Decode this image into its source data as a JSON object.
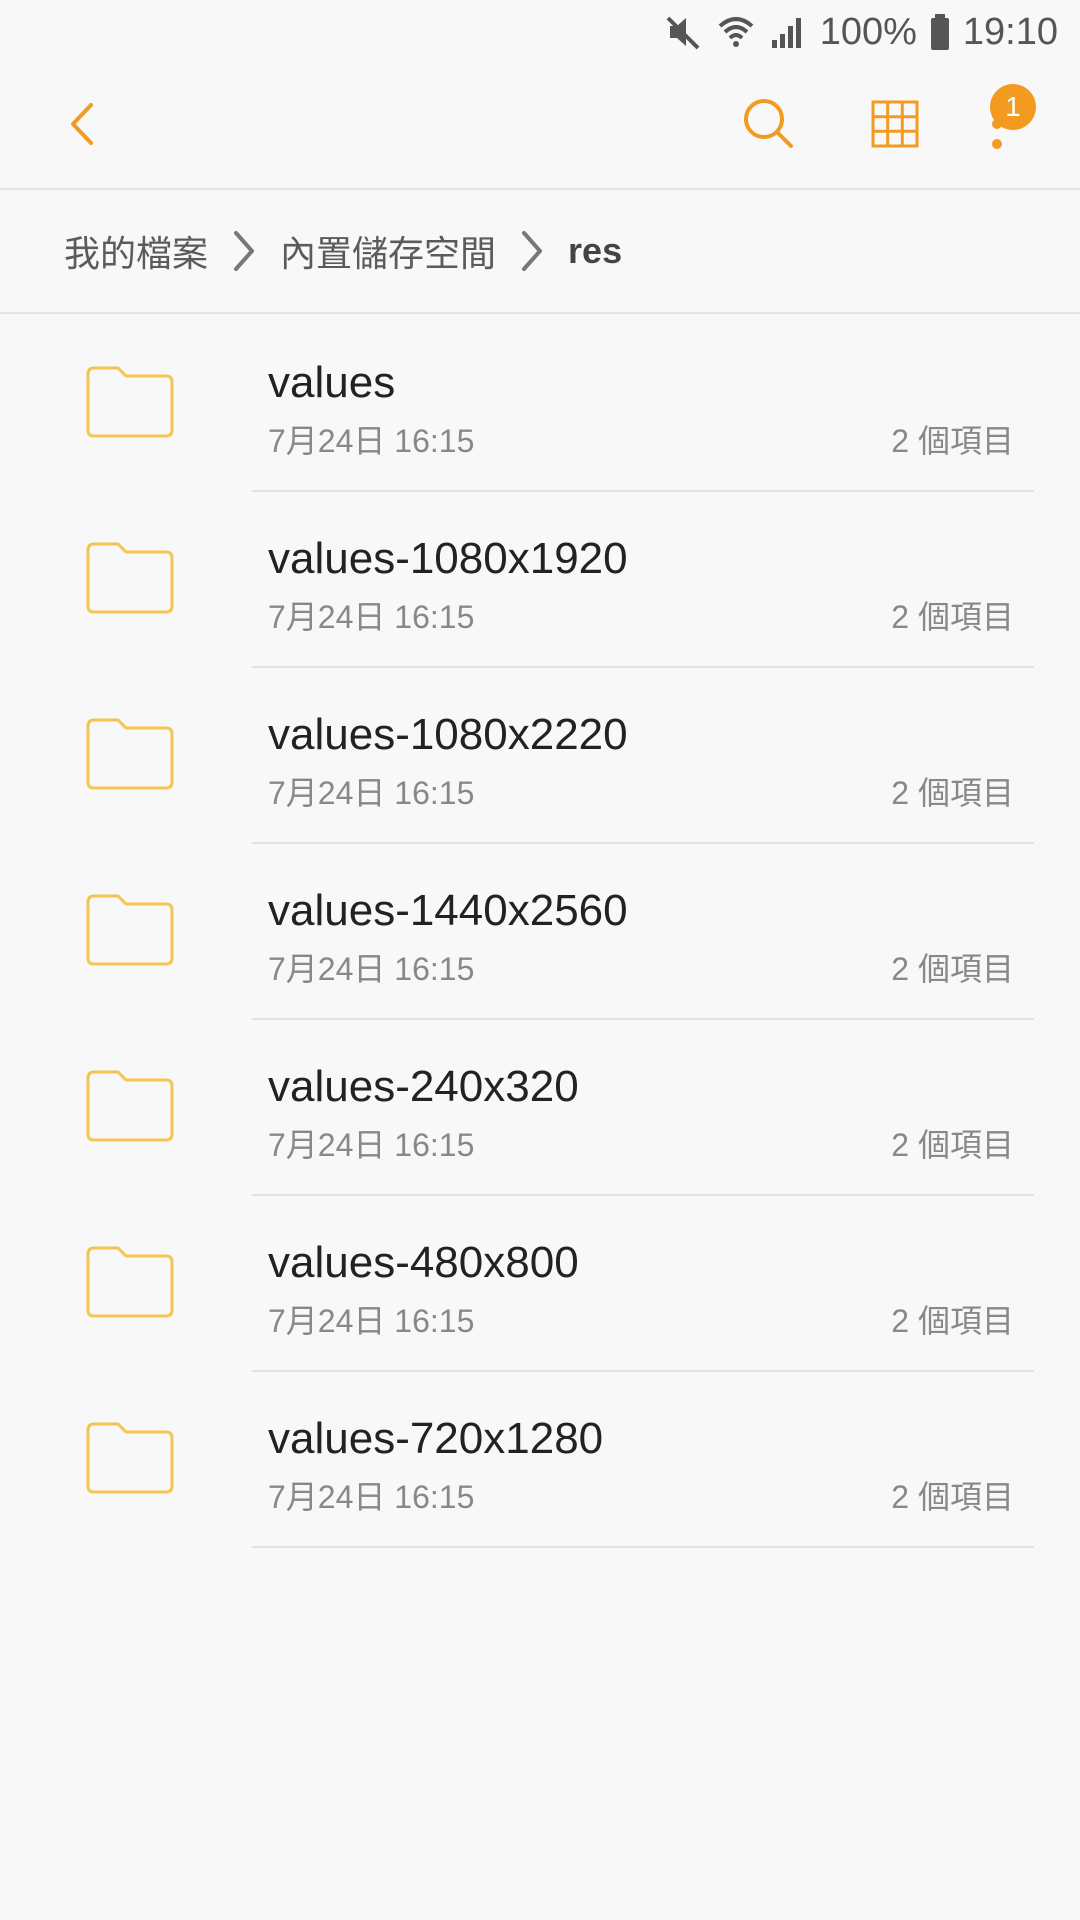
{
  "status_bar": {
    "battery": "100%",
    "time": "19:10",
    "icons": [
      "mute-icon",
      "wifi-icon",
      "signal-icon",
      "battery-icon"
    ]
  },
  "toolbar": {
    "icons": [
      "back-arrow-icon",
      "search-icon",
      "grid-view-icon",
      "more-options-icon"
    ],
    "badge_count": "1",
    "accent_color": "#f39a21"
  },
  "breadcrumb": {
    "items": [
      "我的檔案",
      "內置儲存空間",
      "res"
    ]
  },
  "files": [
    {
      "name": "values",
      "date": "7月24日 16:15",
      "count": "2 個項目"
    },
    {
      "name": "values-1080x1920",
      "date": "7月24日 16:15",
      "count": "2 個項目"
    },
    {
      "name": "values-1080x2220",
      "date": "7月24日 16:15",
      "count": "2 個項目"
    },
    {
      "name": "values-1440x2560",
      "date": "7月24日 16:15",
      "count": "2 個項目"
    },
    {
      "name": "values-240x320",
      "date": "7月24日 16:15",
      "count": "2 個項目"
    },
    {
      "name": "values-480x800",
      "date": "7月24日 16:15",
      "count": "2 個項目"
    },
    {
      "name": "values-720x1280",
      "date": "7月24日 16:15",
      "count": "2 個項目"
    }
  ],
  "colors": {
    "accent": "#f39a21",
    "folder": "#f3c552",
    "background": "#f8f8f8"
  }
}
